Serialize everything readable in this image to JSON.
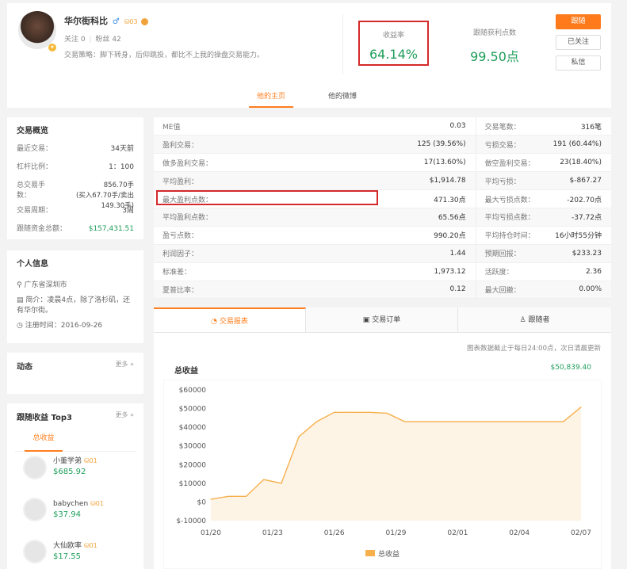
{
  "profile": {
    "name": "华尔街科比",
    "gender_symbol": "♂",
    "level": "03",
    "follows_label": "关注",
    "follows": "0",
    "fans_label": "粉丝",
    "fans": "42",
    "strategy_label": "交易策略：",
    "strategy": "脚下转身，后仰跳投，都比不上我的操盘交易能力。"
  },
  "stats": {
    "return_label": "收益率",
    "return_value": "64.14%",
    "follow_label": "跟随获利点数",
    "follow_value": "99.50点"
  },
  "buttons": {
    "follow": "跟随",
    "followed": "已关注",
    "message": "私信"
  },
  "tabs": {
    "home": "他的主页",
    "weibo": "他的微博"
  },
  "overview": {
    "title": "交易概览",
    "rows": [
      {
        "label": "最近交易：",
        "value": "34天前"
      },
      {
        "label": "杠杆比例：",
        "value": "1：100"
      },
      {
        "label": "总交易手数：",
        "value": "856.70手",
        "sub": "(买入67.70手/卖出149.30手)"
      },
      {
        "label": "交易周期：",
        "value": "3周"
      },
      {
        "label": "跟随资金总额：",
        "value": "$157,431.51"
      }
    ]
  },
  "personal": {
    "title": "个人信息",
    "location": "广东省深圳市",
    "intro": "简介：凌晨4点，除了洛杉矶，还有华尔街。",
    "register": "注册时间：2016-09-26"
  },
  "dynamics": {
    "title": "动态",
    "more": "更多 »"
  },
  "top3": {
    "title": "跟随收益 Top3",
    "more": "更多 »",
    "tab": "总收益",
    "items": [
      {
        "name": "小董学弟",
        "level": "01",
        "value": "$685.92"
      },
      {
        "name": "babychen",
        "level": "01",
        "value": "$37.94"
      },
      {
        "name": "大仙欧率",
        "level": "01",
        "value": "$17.55"
      }
    ]
  },
  "metrics": [
    [
      "ME值",
      "0.03",
      "交易笔数：",
      "316笔"
    ],
    [
      "盈利交易：",
      "125 (39.56%)",
      "亏损交易：",
      "191 (60.44%)"
    ],
    [
      "做多盈利交易：",
      "17(13.60%)",
      "做空盈利交易：",
      "23(18.40%)"
    ],
    [
      "平均盈利：",
      "$1,914.78",
      "平均亏损：",
      "$-867.27"
    ],
    [
      "最大盈利点数：",
      "471.30点",
      "最大亏损点数：",
      "-202.70点"
    ],
    [
      "平均盈利点数：",
      "65.56点",
      "平均亏损点数：",
      "-37.72点"
    ],
    [
      "盈亏点数：",
      "990.20点",
      "平均持仓时间：",
      "16小时55分钟"
    ],
    [
      "利润因子：",
      "1.44",
      "预期回报：",
      "$233.23"
    ],
    [
      "标准差：",
      "1,973.12",
      "活跃度：",
      "2.36"
    ],
    [
      "夏普比率：",
      "0.12",
      "最大回撤：",
      "0.00%"
    ]
  ],
  "report_tabs": {
    "report": "交易报表",
    "orders": "交易订单",
    "followers": "跟随者"
  },
  "chart_note": "图表数据截止于每日24:00点，次日清晨更新",
  "chart_title": "总收益",
  "chart_total": "$50,839.40",
  "chart_data": {
    "type": "area",
    "title": "总收益",
    "xlabel": "",
    "ylabel": "",
    "x_ticks": [
      "01/20",
      "01/23",
      "01/26",
      "01/29",
      "02/01",
      "02/04",
      "02/07"
    ],
    "y_ticks": [
      "$60000",
      "$50000",
      "$40000",
      "$30000",
      "$20000",
      "$10000",
      "$0",
      "$-10000"
    ],
    "ylim": [
      -10000,
      60000
    ],
    "series": [
      {
        "name": "总收益",
        "x": [
          0,
          1,
          2,
          3,
          4,
          5,
          6,
          7,
          8,
          9,
          10,
          11,
          12,
          13,
          14,
          15,
          16,
          17,
          18,
          19,
          20,
          21
        ],
        "values": [
          1500,
          3000,
          3000,
          12000,
          10000,
          35000,
          43000,
          48000,
          48000,
          48000,
          47500,
          43000,
          43000,
          43000,
          43000,
          43000,
          43000,
          43000,
          43000,
          43000,
          43000,
          50800
        ]
      }
    ],
    "legend": "bottom",
    "color": "#f7b04c"
  }
}
